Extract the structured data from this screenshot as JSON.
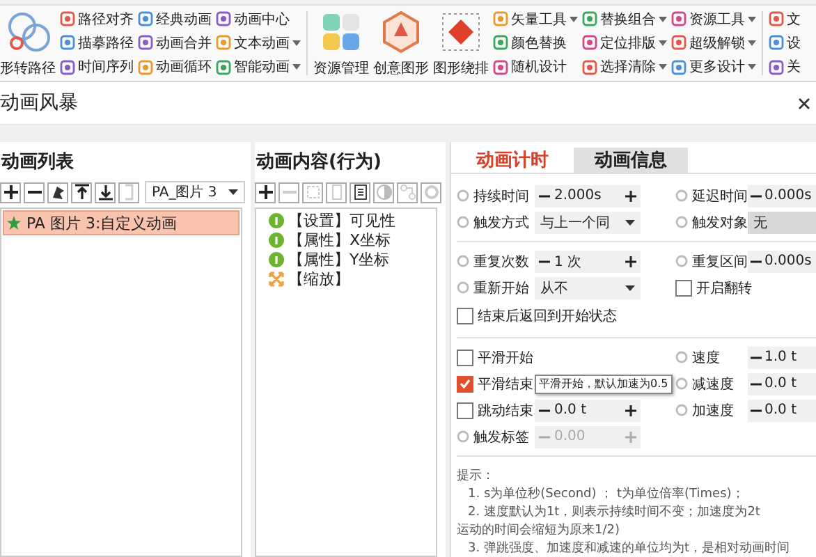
{
  "ribbon": {
    "sections": [
      {
        "kind": "large",
        "label": "形转路径"
      },
      {
        "kind": "column",
        "items": [
          {
            "label": "路径对齐",
            "dropdown": false
          },
          {
            "label": "描摹路径",
            "dropdown": false
          },
          {
            "label": "时间序列",
            "dropdown": false
          }
        ]
      },
      {
        "kind": "column",
        "items": [
          {
            "label": "经典动画",
            "dropdown": false
          },
          {
            "label": "动画合并",
            "dropdown": false
          },
          {
            "label": "动画循环",
            "dropdown": false
          }
        ]
      },
      {
        "kind": "column",
        "items": [
          {
            "label": "动画中心",
            "dropdown": false
          },
          {
            "label": "文本动画",
            "dropdown": true
          },
          {
            "label": "智能动画",
            "dropdown": true
          }
        ]
      },
      {
        "kind": "separator"
      },
      {
        "kind": "large",
        "label": "资源管理"
      },
      {
        "kind": "large",
        "label": "创意图形"
      },
      {
        "kind": "large",
        "label": "图形绕排"
      },
      {
        "kind": "column",
        "items": [
          {
            "label": "矢量工具",
            "dropdown": true
          },
          {
            "label": "颜色替换",
            "dropdown": false
          },
          {
            "label": "随机设计",
            "dropdown": false
          }
        ]
      },
      {
        "kind": "column",
        "items": [
          {
            "label": "替换组合",
            "dropdown": true
          },
          {
            "label": "定位排版",
            "dropdown": true
          },
          {
            "label": "选择清除",
            "dropdown": true
          }
        ]
      },
      {
        "kind": "column",
        "items": [
          {
            "label": "资源工具",
            "dropdown": true
          },
          {
            "label": "超级解锁",
            "dropdown": true
          },
          {
            "label": "更多设计",
            "dropdown": true
          }
        ]
      },
      {
        "kind": "separator"
      },
      {
        "kind": "column",
        "items": [
          {
            "label": "文",
            "dropdown": false
          },
          {
            "label": "设",
            "dropdown": false
          },
          {
            "label": "关",
            "dropdown": false
          }
        ]
      }
    ]
  },
  "window": {
    "title": "动画风暴"
  },
  "animation_list": {
    "title": "动画列表",
    "shape_select": "PA_图片 3",
    "items": [
      {
        "label": "PA 图片 3:自定义动画",
        "selected": true
      }
    ]
  },
  "behaviors": {
    "title": "动画内容(行为)",
    "items": [
      {
        "kind": "info",
        "label": "【设置】可见性"
      },
      {
        "kind": "info",
        "label": "【属性】X坐标"
      },
      {
        "kind": "info",
        "label": "【属性】Y坐标"
      },
      {
        "kind": "scale",
        "label": "【缩放】"
      }
    ]
  },
  "timing": {
    "tabs": [
      {
        "label": "动画计时",
        "selected": true
      },
      {
        "label": "动画信息",
        "selected": false
      }
    ],
    "rows": [
      {
        "kind": "fields",
        "cells": [
          {
            "kind": "spinner",
            "label": "持续时间",
            "value": "2.000s",
            "plus": true,
            "disabled": false
          },
          {
            "kind": "spinner",
            "label": "延迟时间",
            "value": "0.000s",
            "disabled": false
          }
        ]
      },
      {
        "kind": "fields",
        "cells": [
          {
            "kind": "dropdown",
            "label": "触发方式",
            "value": "与上一个同"
          },
          {
            "kind": "field",
            "label": "触发对象",
            "value": "无"
          }
        ]
      },
      {
        "kind": "divider"
      },
      {
        "kind": "fields",
        "cells": [
          {
            "kind": "spinner",
            "label": "重复次数",
            "value": "1 次",
            "plus": true,
            "disabled": false
          },
          {
            "kind": "spinner",
            "label": "重复区间",
            "value": "0.000s",
            "disabled": false
          }
        ]
      },
      {
        "kind": "fields",
        "cells": [
          {
            "kind": "dropdown",
            "label": "重新开始",
            "value": "从不"
          },
          {
            "kind": "checkbox",
            "label": "开启翻转",
            "checked": false
          }
        ]
      },
      {
        "kind": "fields",
        "cells": [
          {
            "kind": "checkbox",
            "label": "结束后返回到开始状态",
            "checked": false
          }
        ]
      },
      {
        "kind": "divider"
      },
      {
        "kind": "fields",
        "cells": [
          {
            "kind": "checkbox",
            "label": "平滑开始",
            "checked": false
          },
          {
            "kind": "spinner",
            "label": "速度",
            "value": "1.0 t",
            "disabled": false
          }
        ]
      },
      {
        "kind": "fields",
        "cells": [
          {
            "kind": "checkbox",
            "label": "平滑结束",
            "checked": true
          },
          {
            "kind": "spinner",
            "label": "减速度",
            "value": "0.0 t",
            "disabled": false
          }
        ]
      },
      {
        "kind": "fields",
        "cells": [
          {
            "kind": "checkspin",
            "label": "跳动结束",
            "checked": false,
            "value": "0.0 t"
          },
          {
            "kind": "spinner",
            "label": "加速度",
            "value": "0.0 t",
            "disabled": false
          }
        ]
      },
      {
        "kind": "fields",
        "cells": [
          {
            "kind": "spinner",
            "label": "触发标签",
            "value": "0.00",
            "plus": true,
            "disabled": true
          }
        ]
      },
      {
        "kind": "divider"
      }
    ],
    "hints": {
      "title": "提示：",
      "lines": [
        "1. s为单位秒(Second) ； t为单位倍率(Times)；",
        "2. 速度默认为1t，则表示持续时间不变；加速度为2t",
        "运动的时间会缩短为原来1/2)",
        "3. 弹跳强度、加速度和减速的单位均为t，是相对动画时间"
      ]
    },
    "tooltip": "平滑开始，默认加速为0.5"
  }
}
